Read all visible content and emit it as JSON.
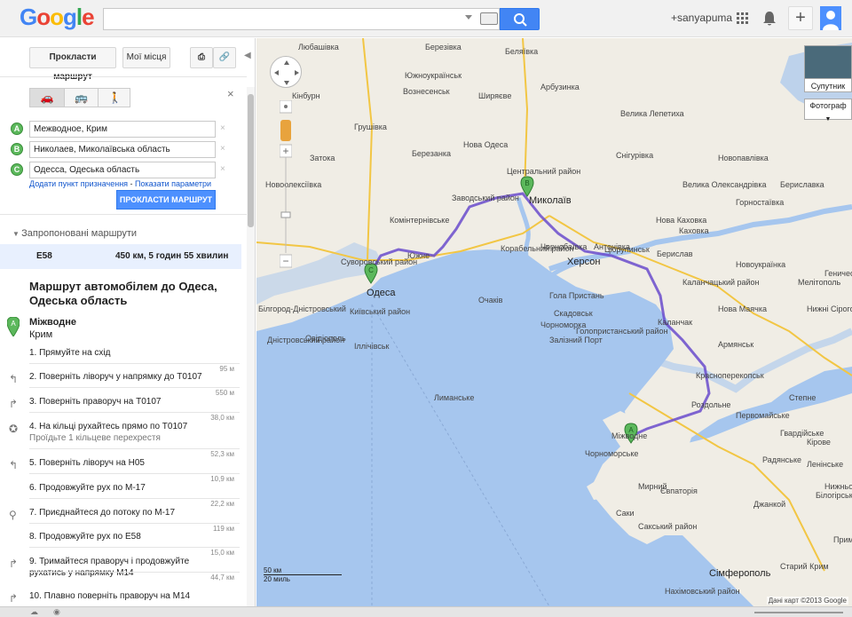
{
  "header": {
    "logo": [
      "G",
      "o",
      "o",
      "g",
      "l",
      "e"
    ],
    "logo_colors": [
      "#4285f4",
      "#ea4335",
      "#fbbc05",
      "#4285f4",
      "#34a853",
      "#ea4335"
    ],
    "user": "+sanyapuma"
  },
  "panel": {
    "route_tab": "Прокласти маршрут",
    "places_tab": "Мої місця",
    "waypoints": [
      {
        "letter": "A",
        "value": "Межводное, Крим"
      },
      {
        "letter": "B",
        "value": "Николаев, Миколаївська область"
      },
      {
        "letter": "C",
        "value": "Одесса, Одеська область"
      }
    ],
    "add_dest": "Додати пункт призначення",
    "sep": " - ",
    "show_params": "Показати параметри",
    "route_button": "ПРОКЛАСТИ МАРШРУТ",
    "suggested_header": "Запропоновані маршрути",
    "suggested": {
      "road": "E58",
      "info": "450 км, 5 годин 55 хвилин"
    },
    "directions_title": "Маршрут автомобілем до Одеса, Одеська область",
    "start": {
      "letter": "A",
      "name": "Міжводне",
      "sub": "Крим"
    },
    "steps": [
      {
        "text": "1. Прямуйте на схід",
        "sub": "",
        "dist": "95 м"
      },
      {
        "text": "2. Поверніть ліворуч у напрямку до T0107",
        "sub": "",
        "dist": "550 м"
      },
      {
        "text": "3. Поверніть праворуч на T0107",
        "sub": "",
        "dist": "38,0 км"
      },
      {
        "text": "4. На кільці рухайтесь прямо по T0107",
        "sub": "Проїдьте 1 кільцеве перехрестя",
        "dist": "52,3 км"
      },
      {
        "text": "5. Поверніть ліворуч на H05",
        "sub": "",
        "dist": "10,9 км"
      },
      {
        "text": "6. Продовжуйте рух по M-17",
        "sub": "",
        "dist": "22,2 км"
      },
      {
        "text": "7. Приєднайтеся до потоку по M-17",
        "sub": "",
        "dist": "119 км"
      },
      {
        "text": "8. Продовжуйте рух по E58",
        "sub": "",
        "dist": "15,0 км"
      },
      {
        "text": "9. Тримайтеся праворуч і продовжуйте рухатись у напрямку M14",
        "sub": "",
        "dist": "44,7 км"
      },
      {
        "text": "10. Плавно поверніть праворуч на M14",
        "sub": "",
        "dist": ""
      }
    ]
  },
  "map": {
    "satellite_label": "Супутник",
    "photos_label": "Фотограф",
    "scale_km": "50 км",
    "scale_mi": "20 миль",
    "credit": "Дані карт ©2013 Google",
    "markers": [
      "A",
      "B",
      "C"
    ],
    "cities": [
      {
        "name": "Одеса",
        "cls": "big"
      },
      {
        "name": "Миколаїв",
        "cls": "big"
      },
      {
        "name": "Херсон",
        "cls": "big"
      },
      {
        "name": "Суворовський район",
        "cls": ""
      },
      {
        "name": "Київський район",
        "cls": ""
      },
      {
        "name": "Центральний район",
        "cls": ""
      },
      {
        "name": "Заводський район",
        "cls": ""
      },
      {
        "name": "Корабельний район",
        "cls": ""
      },
      {
        "name": "Южне",
        "cls": ""
      },
      {
        "name": "Нова Каховка",
        "cls": ""
      },
      {
        "name": "Каховка",
        "cls": ""
      },
      {
        "name": "Цюрупинськ",
        "cls": ""
      },
      {
        "name": "Армянськ",
        "cls": ""
      },
      {
        "name": "Красноперекопськ",
        "cls": ""
      },
      {
        "name": "Міжводне",
        "cls": ""
      },
      {
        "name": "Чорноморське",
        "cls": ""
      },
      {
        "name": "Євпаторія",
        "cls": ""
      },
      {
        "name": "Сімферополь",
        "cls": "big"
      },
      {
        "name": "Нахімовський район",
        "cls": ""
      },
      {
        "name": "Роздольне",
        "cls": ""
      },
      {
        "name": "Первомайське",
        "cls": ""
      },
      {
        "name": "Мирний",
        "cls": ""
      },
      {
        "name": "Скадовськ",
        "cls": ""
      },
      {
        "name": "Гола Пристань",
        "cls": ""
      },
      {
        "name": "Каланчак",
        "cls": ""
      },
      {
        "name": "Нова Одеса",
        "cls": ""
      },
      {
        "name": "Любашівка",
        "cls": ""
      },
      {
        "name": "Южноукраїнськ",
        "cls": ""
      },
      {
        "name": "Вознесенськ",
        "cls": ""
      },
      {
        "name": "Снігурівка",
        "cls": ""
      },
      {
        "name": "Берислав",
        "cls": ""
      },
      {
        "name": "Комінтернівське",
        "cls": ""
      },
      {
        "name": "Іллічівськ",
        "cls": ""
      },
      {
        "name": "Овідіополь",
        "cls": ""
      },
      {
        "name": "Дністровський район",
        "cls": ""
      },
      {
        "name": "Білгород-Дністровський",
        "cls": ""
      },
      {
        "name": "Новопавлівка",
        "cls": ""
      },
      {
        "name": "Велика Олександрівка",
        "cls": ""
      },
      {
        "name": "Бериславка",
        "cls": ""
      },
      {
        "name": "Новоукраїнка",
        "cls": ""
      },
      {
        "name": "Нижні Сірогози",
        "cls": ""
      },
      {
        "name": "Мелітополь",
        "cls": ""
      },
      {
        "name": "Радянське",
        "cls": ""
      },
      {
        "name": "Гвардійське",
        "cls": ""
      },
      {
        "name": "Білогірськ",
        "cls": ""
      },
      {
        "name": "Залізний Порт",
        "cls": ""
      },
      {
        "name": "Саки",
        "cls": ""
      },
      {
        "name": "Сакський район",
        "cls": ""
      },
      {
        "name": "Ленінське",
        "cls": ""
      },
      {
        "name": "Нижньогірський",
        "cls": ""
      },
      {
        "name": "Велика Лепетиха",
        "cls": ""
      },
      {
        "name": "Горностаївка",
        "cls": ""
      },
      {
        "name": "Каланчацький район",
        "cls": ""
      },
      {
        "name": "Чорнобаївка",
        "cls": ""
      },
      {
        "name": "Антонівка",
        "cls": ""
      },
      {
        "name": "Чорноморка",
        "cls": ""
      },
      {
        "name": "Голопристанський район",
        "cls": ""
      },
      {
        "name": "Нова Маячка",
        "cls": ""
      },
      {
        "name": "Старий Крим",
        "cls": ""
      },
      {
        "name": "Джанкой",
        "cls": ""
      },
      {
        "name": "Степне",
        "cls": ""
      },
      {
        "name": "Кірове",
        "cls": ""
      },
      {
        "name": "Приморське",
        "cls": ""
      },
      {
        "name": "Геническ",
        "cls": ""
      },
      {
        "name": "Арбузинка",
        "cls": ""
      },
      {
        "name": "Лиманське",
        "cls": ""
      },
      {
        "name": "Грушівка",
        "cls": ""
      },
      {
        "name": "Кінбурн",
        "cls": ""
      },
      {
        "name": "Очаків",
        "cls": ""
      },
      {
        "name": "Березанка",
        "cls": ""
      },
      {
        "name": "Березівка",
        "cls": ""
      },
      {
        "name": "Беляївка",
        "cls": ""
      },
      {
        "name": "Ширяєве",
        "cls": ""
      },
      {
        "name": "Затока",
        "cls": ""
      },
      {
        "name": "Новоолексіївка",
        "cls": ""
      }
    ]
  }
}
